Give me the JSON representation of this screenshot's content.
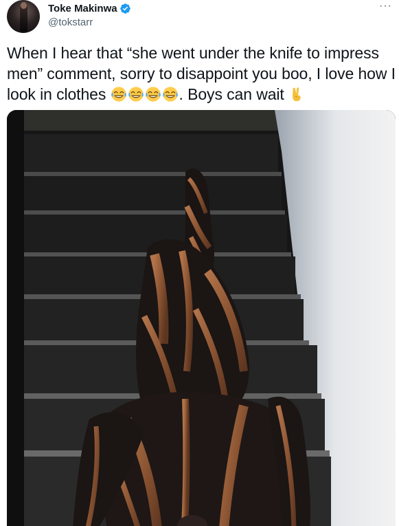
{
  "tweet": {
    "author": {
      "display_name": "Toke Makinwa",
      "handle": "@tokstarr",
      "verified": true,
      "verified_color": "#1d9bf0"
    },
    "more_label": "···",
    "text": {
      "part1": "When I hear that “she went under the knife to impress men” comment, sorry to disappoint you boo, I love how I look in clothes ",
      "emojis": [
        "laughing-crying-emoji",
        "laughing-crying-emoji",
        "laughing-crying-emoji",
        "laughing-crying-emoji"
      ],
      "part2": ". Boys can wait ",
      "end_emoji": "victory-hand-emoji"
    },
    "media": {
      "type": "photo"
    }
  }
}
